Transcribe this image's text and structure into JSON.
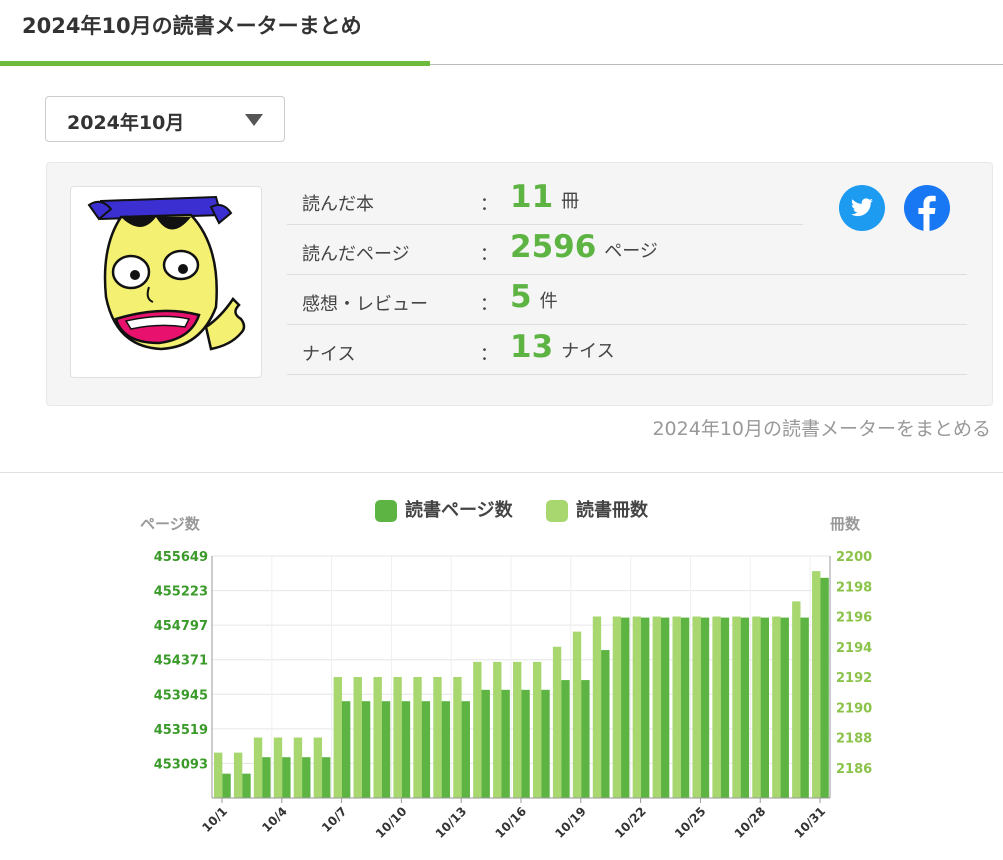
{
  "page": {
    "title": "2024年10月の読書メーターまとめ"
  },
  "month_select": {
    "value": "2024年10月"
  },
  "stats": [
    {
      "label": "読んだ本",
      "colon": "：",
      "value": "11",
      "unit": "冊"
    },
    {
      "label": "読んだページ",
      "colon": "：",
      "value": "2596",
      "unit": "ページ"
    },
    {
      "label": "感想・レビュー",
      "colon": "：",
      "value": "5",
      "unit": "件"
    },
    {
      "label": "ナイス",
      "colon": "：",
      "value": "13",
      "unit": "ナイス"
    }
  ],
  "share": {
    "twitter_icon": "twitter-icon",
    "facebook_icon": "facebook-icon"
  },
  "summarize_link": "2024年10月の読書メーターをまとめる",
  "colors": {
    "accent": "#6cbb3c",
    "pages": "#5db443",
    "books": "#a8d770",
    "twitter": "#1d9bf0",
    "facebook": "#1877f2"
  },
  "chart_data": {
    "type": "bar",
    "legend": [
      "読書ページ数",
      "読書冊数"
    ],
    "left_axis_title": "ページ数",
    "right_axis_title": "冊数",
    "left_ticks": [
      "455649",
      "455223",
      "454797",
      "454371",
      "453945",
      "453519",
      "453093"
    ],
    "right_ticks": [
      "2200",
      "2198",
      "2196",
      "2194",
      "2192",
      "2190",
      "2188",
      "2186"
    ],
    "ylim_left": [
      452667,
      455649
    ],
    "ylim_right": [
      2184,
      2200
    ],
    "categories": [
      "10/1",
      "10/2",
      "10/3",
      "10/4",
      "10/5",
      "10/6",
      "10/7",
      "10/8",
      "10/9",
      "10/10",
      "10/11",
      "10/12",
      "10/13",
      "10/14",
      "10/15",
      "10/16",
      "10/17",
      "10/18",
      "10/19",
      "10/20",
      "10/21",
      "10/22",
      "10/23",
      "10/24",
      "10/25",
      "10/26",
      "10/27",
      "10/28",
      "10/29",
      "10/30",
      "10/31"
    ],
    "x_tick_labels": [
      "10/1",
      "10/4",
      "10/7",
      "10/10",
      "10/13",
      "10/16",
      "10/19",
      "10/22",
      "10/25",
      "10/28",
      "10/31"
    ],
    "series": [
      {
        "name": "読書ページ数",
        "axis": "left",
        "values": [
          452967,
          452967,
          453170,
          453170,
          453170,
          453170,
          453860,
          453860,
          453860,
          453860,
          453860,
          453860,
          453860,
          454000,
          454000,
          454000,
          454000,
          454120,
          454120,
          454490,
          454890,
          454890,
          454890,
          454890,
          454890,
          454890,
          454890,
          454890,
          454890,
          454890,
          455380
        ]
      },
      {
        "name": "読書冊数",
        "axis": "right",
        "values": [
          2187,
          2187,
          2188,
          2188,
          2188,
          2188,
          2192,
          2192,
          2192,
          2192,
          2192,
          2192,
          2192,
          2193,
          2193,
          2193,
          2193,
          2194,
          2195,
          2196,
          2196,
          2196,
          2196,
          2196,
          2196,
          2196,
          2196,
          2196,
          2196,
          2197,
          2199
        ]
      }
    ]
  }
}
